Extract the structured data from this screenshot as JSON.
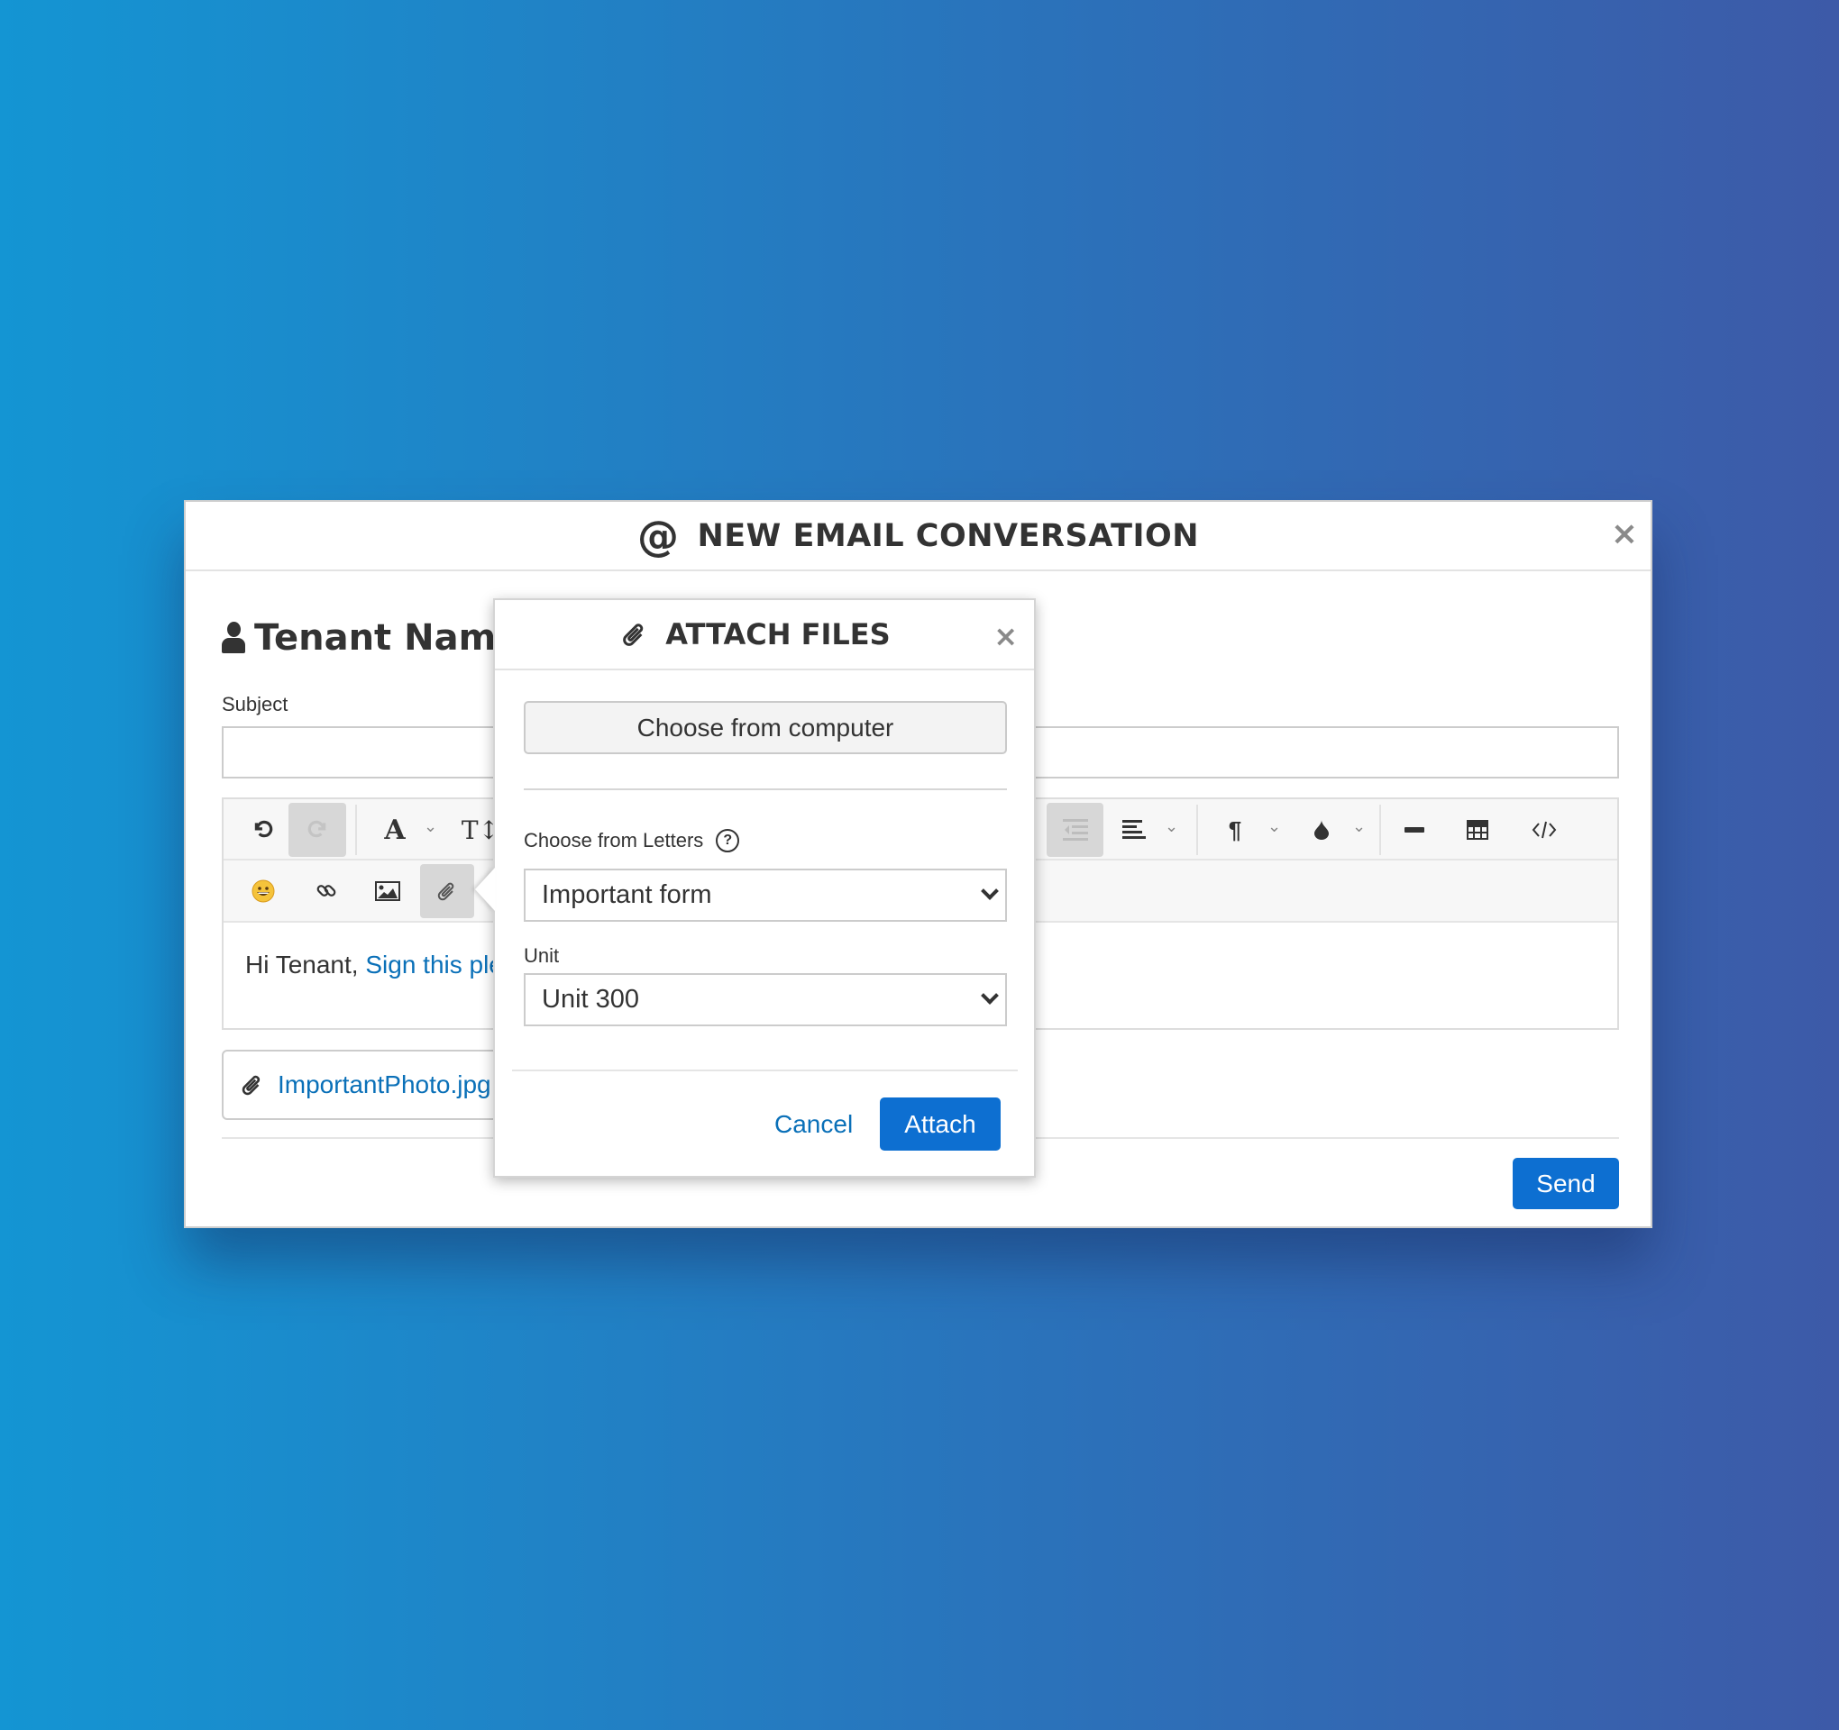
{
  "modal": {
    "title": "NEW EMAIL CONVERSATION",
    "title_icon": "at-icon",
    "close_label": "×",
    "recipient": "Tenant Name",
    "subject_label": "Subject",
    "subject_value": "",
    "editor_text_plain": "Hi Tenant, ",
    "editor_text_link": "Sign this please",
    "attachment_name": "ImportantPhoto.jpg",
    "send_label": "Send"
  },
  "toolbar": {
    "row1": [
      "undo",
      "redo",
      "font-style",
      "font-size",
      "outdent",
      "align",
      "paragraph",
      "color",
      "horizontal-rule",
      "table",
      "code-view"
    ],
    "row2": [
      "emoji",
      "link",
      "image",
      "attach-file"
    ],
    "font_label": "A",
    "size_label": "T↕"
  },
  "attach_popup": {
    "title": "ATTACH FILES",
    "close_label": "×",
    "choose_computer_label": "Choose from computer",
    "letters_label": "Choose from Letters",
    "help_label": "?",
    "letters_selected": "Important form",
    "unit_label": "Unit",
    "unit_selected": "Unit 300",
    "cancel_label": "Cancel",
    "attach_label": "Attach"
  },
  "colors": {
    "primary": "#0d6fd1",
    "link": "#0a70b8",
    "bg_start": "#1495d3",
    "bg_end": "#3d5aa8"
  }
}
